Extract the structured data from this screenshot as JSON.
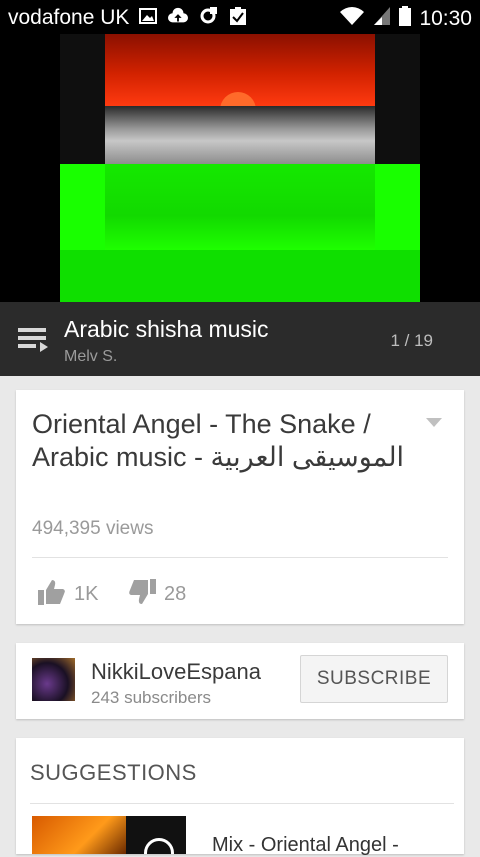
{
  "status_bar": {
    "carrier": "vodafone UK",
    "time": "10:30",
    "icons": [
      "image-icon",
      "cloud-upload-icon",
      "sync-icon",
      "clipboard-check-icon",
      "wifi-icon",
      "signal-icon",
      "battery-icon"
    ]
  },
  "playlist": {
    "title": "Arabic shisha music",
    "owner": "Melv S.",
    "position": "1 / 19",
    "icon": "playlist-icon"
  },
  "video": {
    "title": "Oriental Angel - The Snake / Arabic music - الموسيقى العربية",
    "views": "494,395 views",
    "likes": "1K",
    "dislikes": "28"
  },
  "channel": {
    "name": "NikkiLoveEspana",
    "subscribers": "243 subscribers",
    "subscribe_label": "SUBSCRIBE"
  },
  "suggestions": {
    "heading": "SUGGESTIONS",
    "items": [
      {
        "title": "Mix - Oriental Angel -"
      }
    ]
  },
  "colors": {
    "status_bg": "#000000",
    "playlist_bg": "#2b2b2b",
    "page_bg": "#e9e9e9",
    "card_bg": "#ffffff"
  }
}
